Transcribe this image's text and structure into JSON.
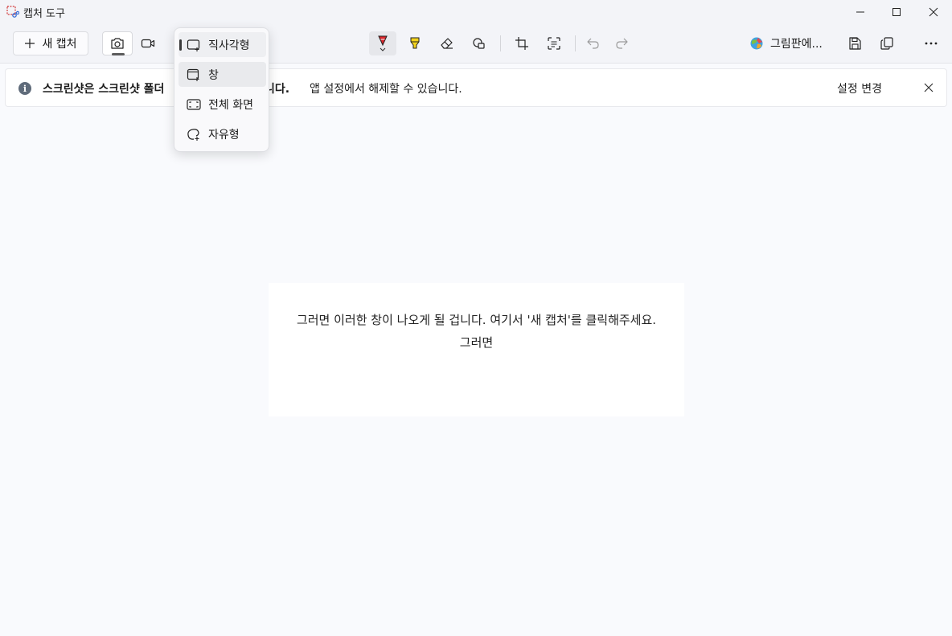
{
  "window": {
    "title": "캡처 도구",
    "controls": [
      "minimize",
      "maximize",
      "close"
    ]
  },
  "toolbar": {
    "new_capture_label": "새 캡처",
    "modes": [
      {
        "name": "screenshot",
        "icon": "camera-icon",
        "active": true
      },
      {
        "name": "record",
        "icon": "video-icon",
        "active": false
      }
    ],
    "tools": [
      {
        "name": "ballpoint-pen",
        "icon": "pen-icon",
        "color": "#d9252b",
        "selected": true
      },
      {
        "name": "highlighter",
        "icon": "highlighter-icon",
        "color": "#f3d31c"
      },
      {
        "name": "eraser",
        "icon": "eraser-icon"
      },
      {
        "name": "shapes",
        "icon": "shapes-icon"
      },
      {
        "name": "crop",
        "icon": "crop-icon"
      },
      {
        "name": "text-actions",
        "icon": "text-actions-icon"
      },
      {
        "name": "undo",
        "icon": "undo-icon",
        "disabled": true
      },
      {
        "name": "redo",
        "icon": "redo-icon",
        "disabled": true
      }
    ],
    "open_in_paint_label": "그림판에...",
    "actions": [
      "save-icon",
      "copy-icon",
      "more-icon"
    ]
  },
  "capture_menu": {
    "items": [
      {
        "label": "직사각형",
        "icon": "rectangle-capture-icon",
        "selected": true
      },
      {
        "label": "창",
        "icon": "window-capture-icon",
        "hover": true
      },
      {
        "label": "전체 화면",
        "icon": "fullscreen-capture-icon"
      },
      {
        "label": "자유형",
        "icon": "freeform-capture-icon"
      }
    ]
  },
  "infobar": {
    "text_bold_start": "스크린샷은 스크린샷 폴더",
    "text_bold_end": "니다.",
    "text": "앱 설정에서 해제할 수 있습니다.",
    "action_label": "설정 변경"
  },
  "canvas": {
    "line1": "그러면 이러한 창이 나오게 될 겁니다. 여기서 '새 캡처'를 클릭해주세요.",
    "line2": "그러면"
  },
  "colors": {
    "accent_pen": "#d9252b",
    "highlighter": "#f3d31c",
    "background": "#f9fafd"
  }
}
